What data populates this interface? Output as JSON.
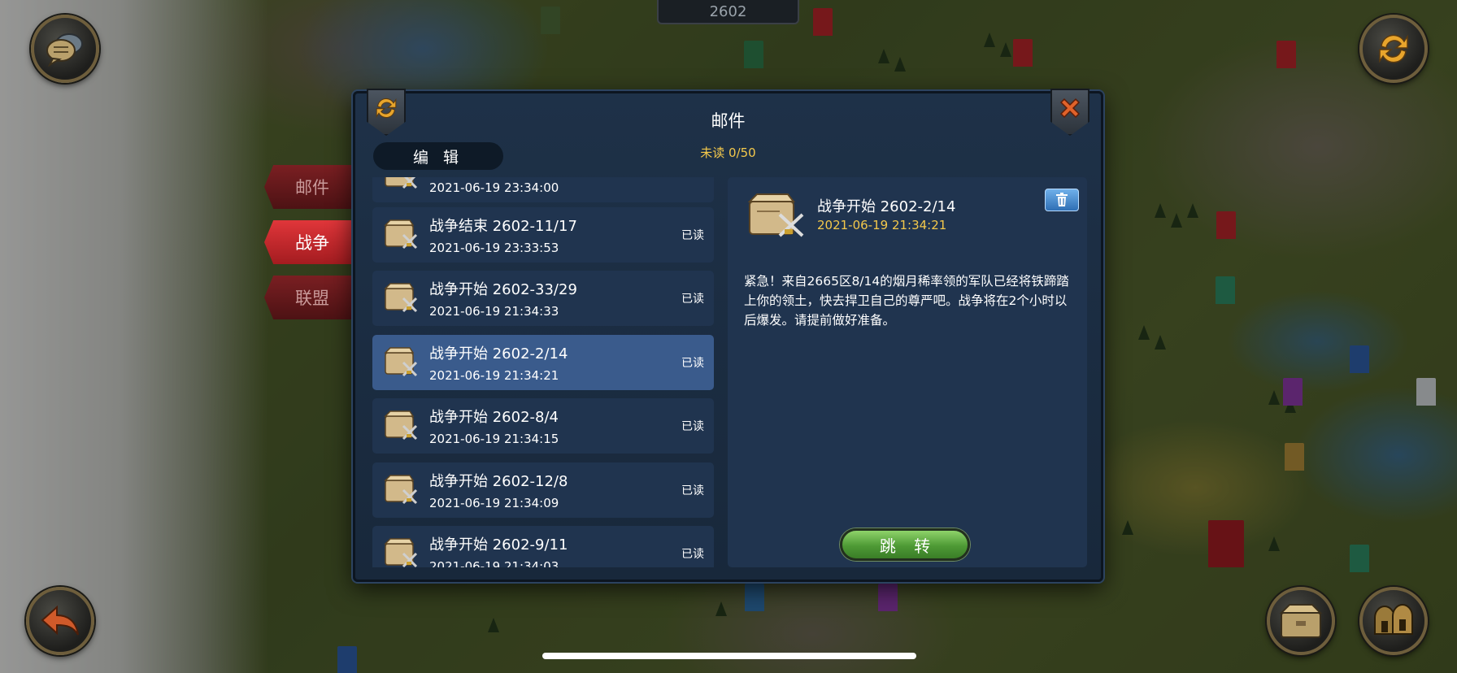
{
  "map": {
    "counter": "2602"
  },
  "dialog": {
    "title": "邮件",
    "unread_label": "未读 0/50",
    "edit_label": "编 辑"
  },
  "side_tabs": [
    {
      "label": "邮件",
      "active": false
    },
    {
      "label": "战争",
      "active": true
    },
    {
      "label": "联盟",
      "active": false
    }
  ],
  "mail_list": [
    {
      "subject": "",
      "date": "2021-06-19 23:34:00",
      "status": "",
      "selected": false
    },
    {
      "subject": "战争结束 2602-11/17",
      "date": "2021-06-19 23:33:53",
      "status": "已读",
      "selected": false
    },
    {
      "subject": "战争开始 2602-33/29",
      "date": "2021-06-19 21:34:33",
      "status": "已读",
      "selected": false
    },
    {
      "subject": "战争开始 2602-2/14",
      "date": "2021-06-19 21:34:21",
      "status": "已读",
      "selected": true
    },
    {
      "subject": "战争开始 2602-8/4",
      "date": "2021-06-19 21:34:15",
      "status": "已读",
      "selected": false
    },
    {
      "subject": "战争开始 2602-12/8",
      "date": "2021-06-19 21:34:09",
      "status": "已读",
      "selected": false
    },
    {
      "subject": "战争开始 2602-9/11",
      "date": "2021-06-19 21:34:03",
      "status": "已读",
      "selected": false
    }
  ],
  "detail": {
    "subject": "战争开始 2602-2/14",
    "date": "2021-06-19 21:34:21",
    "body": "紧急！来自2665区8/14的烟月稀率领的军队已经将铁蹄踏上你的领土，快去捍卫自己的尊严吧。战争将在2个小时以后爆发。请提前做好准备。",
    "jump_label": "跳 转"
  },
  "colors": {
    "accent_gold": "#f3c84b",
    "panel_bg": "#20344f",
    "selected_bg": "#3a5b8c",
    "active_tab": "#e0363a",
    "jump_green": "#4e9a35"
  },
  "icons": [
    "chat-icon",
    "refresh-icon",
    "close-icon",
    "trash-icon",
    "back-arrow-icon",
    "mailbox-icon",
    "helmets-icon",
    "war-mail-icon"
  ]
}
